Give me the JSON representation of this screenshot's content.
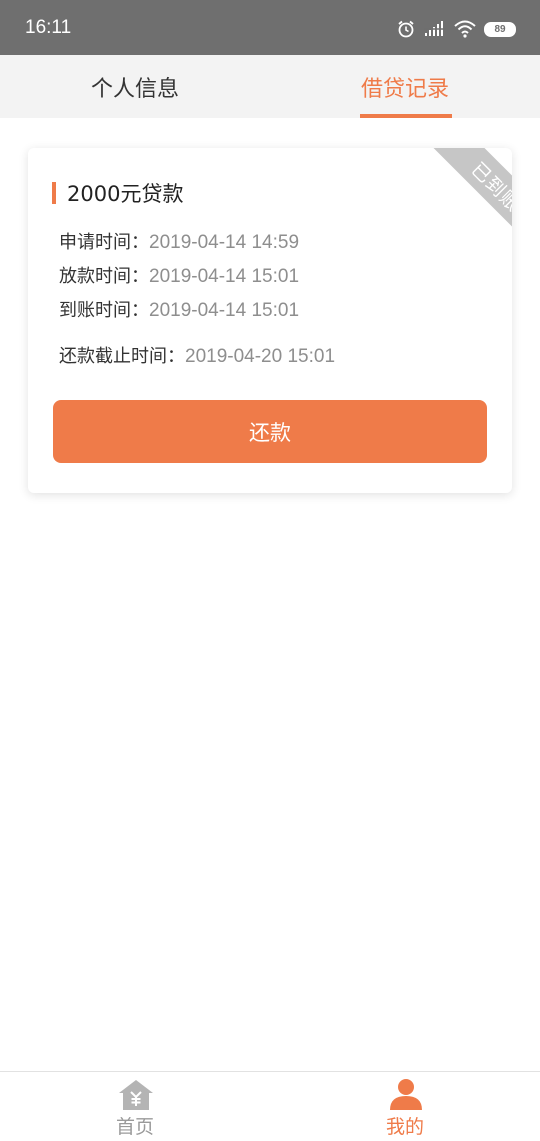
{
  "status_bar": {
    "time": "16:11",
    "battery": "89",
    "icons": [
      "alarm-icon",
      "signal-icon",
      "wifi-icon",
      "battery-icon"
    ]
  },
  "tabs": [
    {
      "label": "个人信息",
      "active": false
    },
    {
      "label": "借贷记录",
      "active": true
    }
  ],
  "loan_card": {
    "title": "2000元贷款",
    "status_ribbon": "已到账",
    "apply_label": "申请时间：",
    "apply_value": "2019-04-14 14:59",
    "disburse_label": "放款时间：",
    "disburse_value": "2019-04-14 15:01",
    "arrive_label": "到账时间：",
    "arrive_value": "2019-04-14 15:01",
    "due_label": "还款截止时间：",
    "due_value": "2019-04-20 15:01",
    "repay_button": "还款"
  },
  "bottom_nav": [
    {
      "label": "首页",
      "icon": "home-icon",
      "active": false
    },
    {
      "label": "我的",
      "icon": "user-icon",
      "active": true
    }
  ],
  "colors": {
    "accent": "#ef7b49",
    "status_bar": "#6f6f6f",
    "tab_bg": "#f3f3f3",
    "ribbon": "#c6c6c6",
    "muted_text": "#8e8e8e"
  }
}
